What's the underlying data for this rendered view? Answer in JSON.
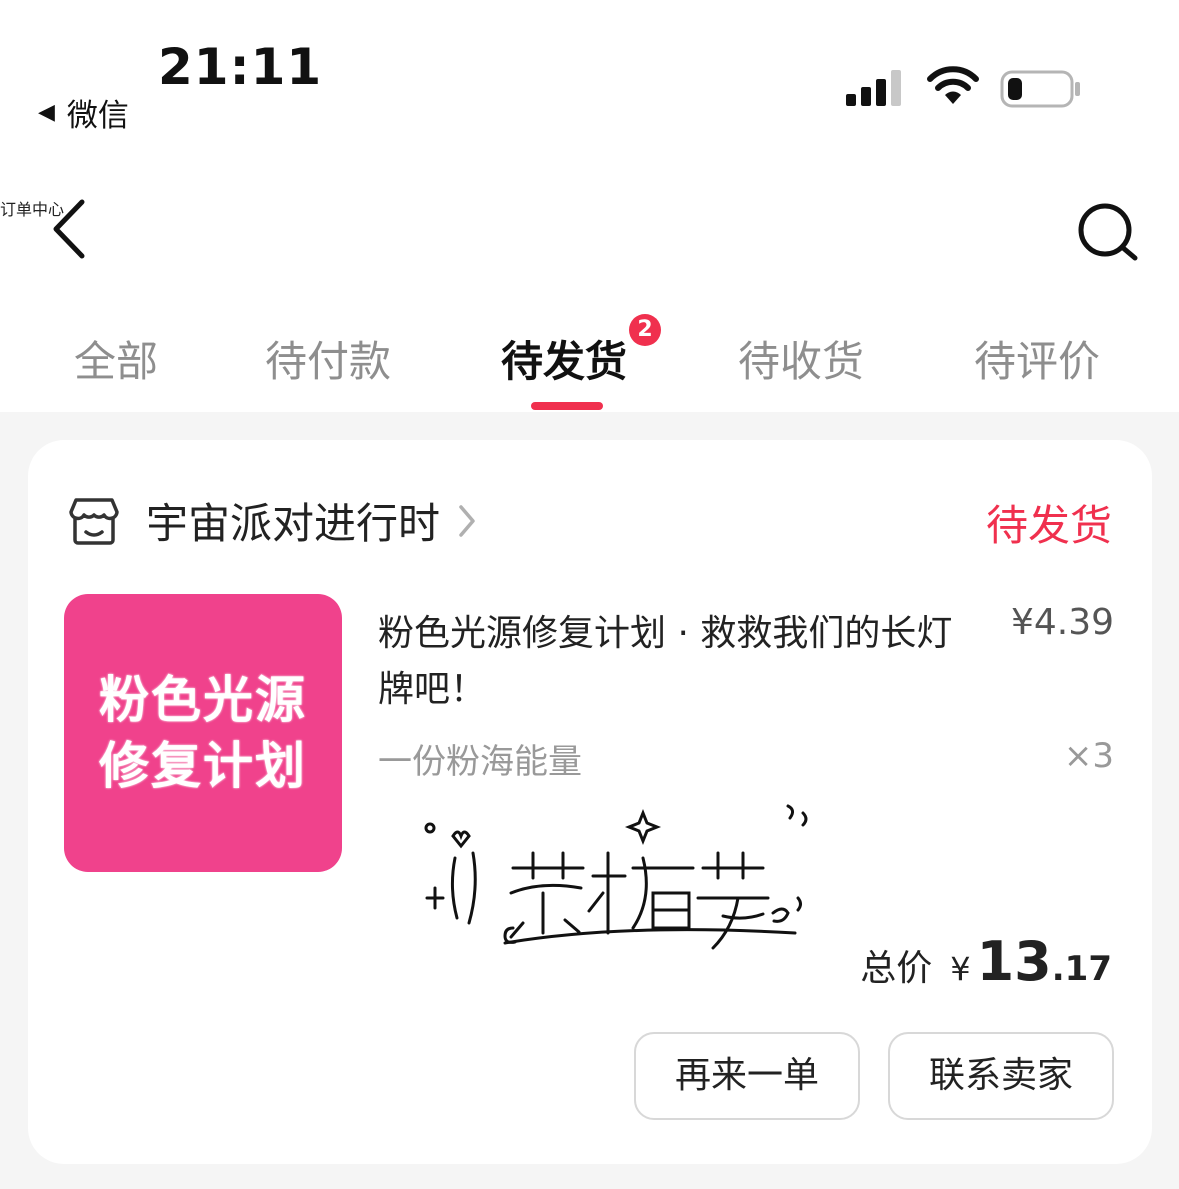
{
  "status_bar": {
    "time": "21:11",
    "back_app_label": "微信",
    "signal_icon": "cellular-signal-icon",
    "wifi_icon": "wifi-icon",
    "battery_icon": "battery-low-icon"
  },
  "nav": {
    "title": "订单中心",
    "back_icon": "chevron-left-icon",
    "search_icon": "search-icon"
  },
  "tabs": {
    "items": [
      {
        "label": "全部"
      },
      {
        "label": "待付款"
      },
      {
        "label": "待发货",
        "badge": "2",
        "active": true
      },
      {
        "label": "待收货"
      },
      {
        "label": "待评价"
      }
    ]
  },
  "order": {
    "shop_name": "宇宙派对进行时",
    "status": "待发货",
    "thumbnail_text": [
      "粉色光源",
      "修复计划"
    ],
    "product_title": "粉色光源修复计划 · 救救我们的长灯牌吧！",
    "unit_price": "¥4.39",
    "variant": "一份粉海能量",
    "quantity": "×3",
    "total_label": "总价",
    "total_currency": "¥",
    "total_integer": "13",
    "total_decimal": ".17",
    "buttons": {
      "reorder": "再来一单",
      "contact": "联系卖家"
    }
  },
  "colors": {
    "accent": "#f0304e",
    "thumbnail_bg": "#f0428c",
    "page_bg": "#f5f5f5"
  }
}
